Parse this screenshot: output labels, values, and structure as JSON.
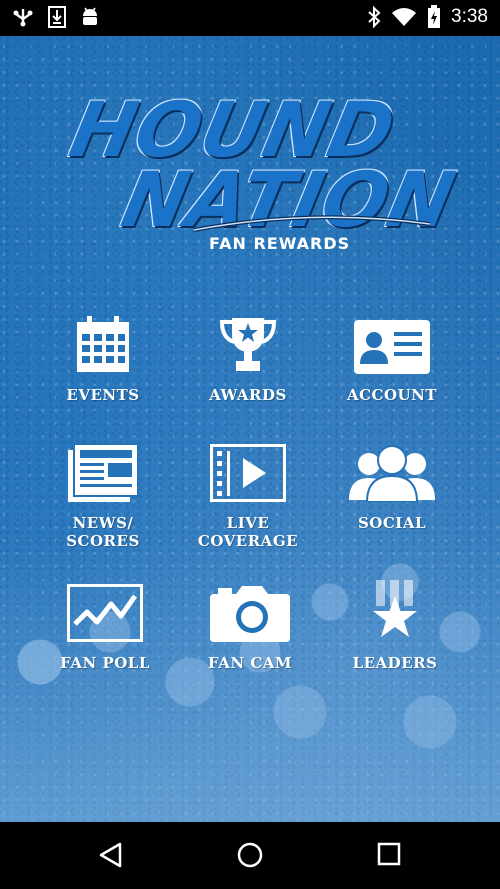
{
  "status_bar": {
    "time": "3:38",
    "icons": [
      "usb-icon",
      "download-icon",
      "android-icon",
      "bluetooth-icon",
      "wifi-icon",
      "battery-icon"
    ]
  },
  "logo": {
    "line1": "HOUND",
    "line2": "NATION",
    "subtitle": "FAN REWARDS"
  },
  "menu": [
    {
      "label": "EVENTS",
      "icon": "calendar-icon"
    },
    {
      "label": "AWARDS",
      "icon": "trophy-icon"
    },
    {
      "label": "ACCOUNT",
      "icon": "id-card-icon"
    },
    {
      "label": "NEWS/\nSCORES",
      "icon": "newspaper-icon"
    },
    {
      "label": "LIVE\nCOVERAGE",
      "icon": "video-play-icon"
    },
    {
      "label": "SOCIAL",
      "icon": "people-icon"
    },
    {
      "label": "FAN POLL",
      "icon": "chart-line-icon"
    },
    {
      "label": "FAN CAM",
      "icon": "camera-icon"
    },
    {
      "label": "LEADERS",
      "icon": "star-bars-icon"
    }
  ],
  "nav_bar": {
    "buttons": [
      "back-icon",
      "home-icon",
      "recents-icon"
    ]
  },
  "colors": {
    "background": "#2472b8",
    "logo_blue": "#1a73c8",
    "icon_white": "#ffffff"
  }
}
